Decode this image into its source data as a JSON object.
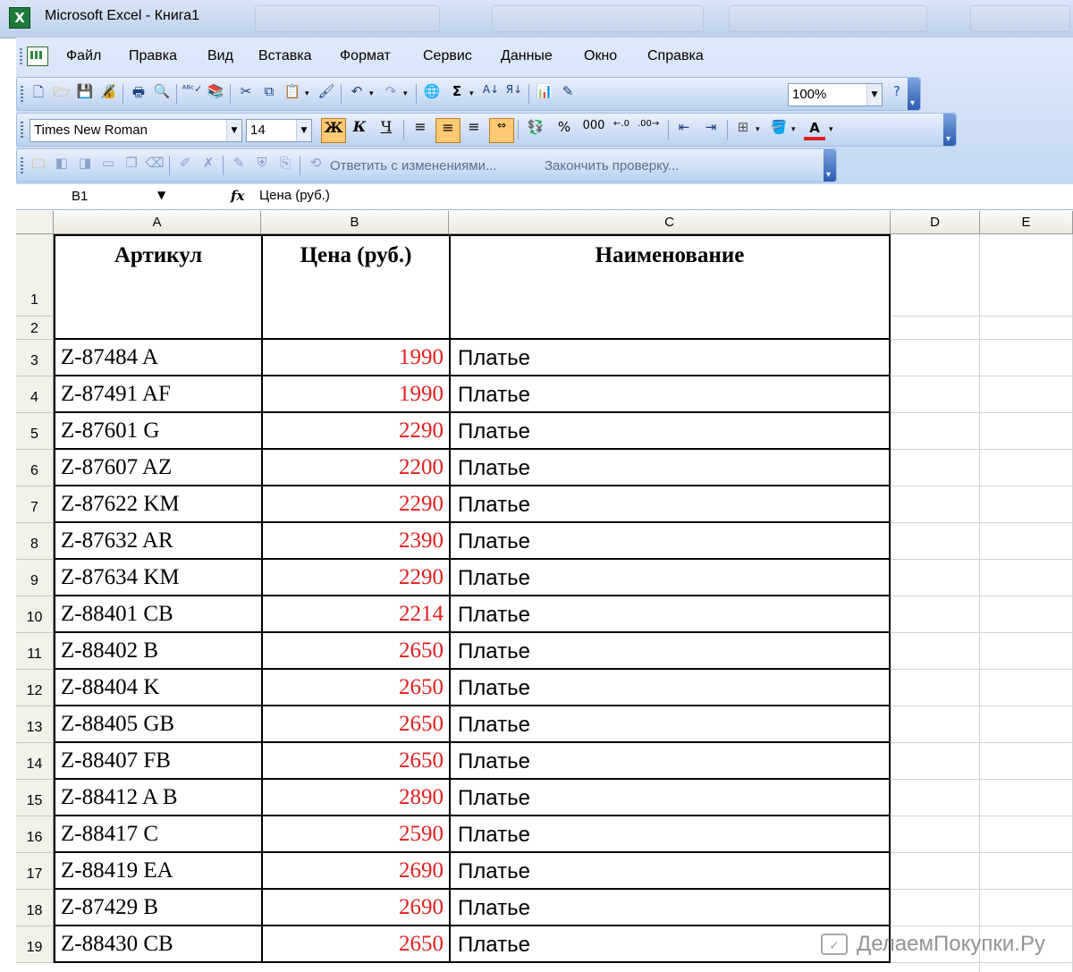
{
  "window": {
    "title": "Microsoft Excel - Книга1",
    "app_icon_letter": "X"
  },
  "menu": {
    "items": [
      "Файл",
      "Правка",
      "Вид",
      "Вставка",
      "Формат",
      "Сервис",
      "Данные",
      "Окно",
      "Справка"
    ]
  },
  "standard_toolbar": {
    "zoom": "100%"
  },
  "format_toolbar": {
    "font_name": "Times New Roman",
    "font_size": "14",
    "bold": "Ж",
    "italic": "К",
    "underline": "Ч",
    "percent": "%",
    "thousands": "000"
  },
  "review_toolbar": {
    "reply_label": "Ответить с изменениями...",
    "finish_label": "Закончить проверку..."
  },
  "formula_bar": {
    "cell_ref": "B1",
    "fx": "fx",
    "content": "Цена (руб.)"
  },
  "sheet": {
    "columns": [
      "A",
      "B",
      "C",
      "D",
      "E"
    ],
    "header_row": {
      "a": "Артикул",
      "b": "Цена (руб.)",
      "c": "Наименование"
    },
    "rows": [
      {
        "num": "3",
        "article": "Z-87484 A",
        "price": "1990",
        "name": "Платье"
      },
      {
        "num": "4",
        "article": "Z-87491 AF",
        "price": "1990",
        "name": "Платье"
      },
      {
        "num": "5",
        "article": "Z-87601 G",
        "price": "2290",
        "name": "Платье"
      },
      {
        "num": "6",
        "article": "Z-87607 AZ",
        "price": "2200",
        "name": "Платье"
      },
      {
        "num": "7",
        "article": "Z-87622 KM",
        "price": "2290",
        "name": "Платье"
      },
      {
        "num": "8",
        "article": "Z-87632 AR",
        "price": "2390",
        "name": "Платье"
      },
      {
        "num": "9",
        "article": "Z-87634 KM",
        "price": "2290",
        "name": "Платье"
      },
      {
        "num": "10",
        "article": "Z-88401 CB",
        "price": "2214",
        "name": "Платье"
      },
      {
        "num": "11",
        "article": "Z-88402 B",
        "price": "2650",
        "name": "Платье"
      },
      {
        "num": "12",
        "article": "Z-88404 K",
        "price": "2650",
        "name": "Платье"
      },
      {
        "num": "13",
        "article": "Z-88405 GB",
        "price": "2650",
        "name": "Платье"
      },
      {
        "num": "14",
        "article": "Z-88407 FB",
        "price": "2650",
        "name": "Платье"
      },
      {
        "num": "15",
        "article": "Z-88412 A  B",
        "price": "2890",
        "name": "Платье"
      },
      {
        "num": "16",
        "article": "Z-88417 C",
        "price": "2590",
        "name": "Платье"
      },
      {
        "num": "17",
        "article": "Z-88419 EA",
        "price": "2690",
        "name": "Платье"
      },
      {
        "num": "18",
        "article": "Z-87429 B",
        "price": "2690",
        "name": "Платье"
      },
      {
        "num": "19",
        "article": "Z-88430 CB",
        "price": "2650",
        "name": "Платье"
      }
    ],
    "row1_num": "1",
    "row2_num": "2"
  },
  "watermark": {
    "text": "ДелаемПокупки.Ру"
  },
  "colors": {
    "price_text": "#e02020",
    "toolbar_bg": "#c4d8f2",
    "active_button": "#ffc973"
  }
}
